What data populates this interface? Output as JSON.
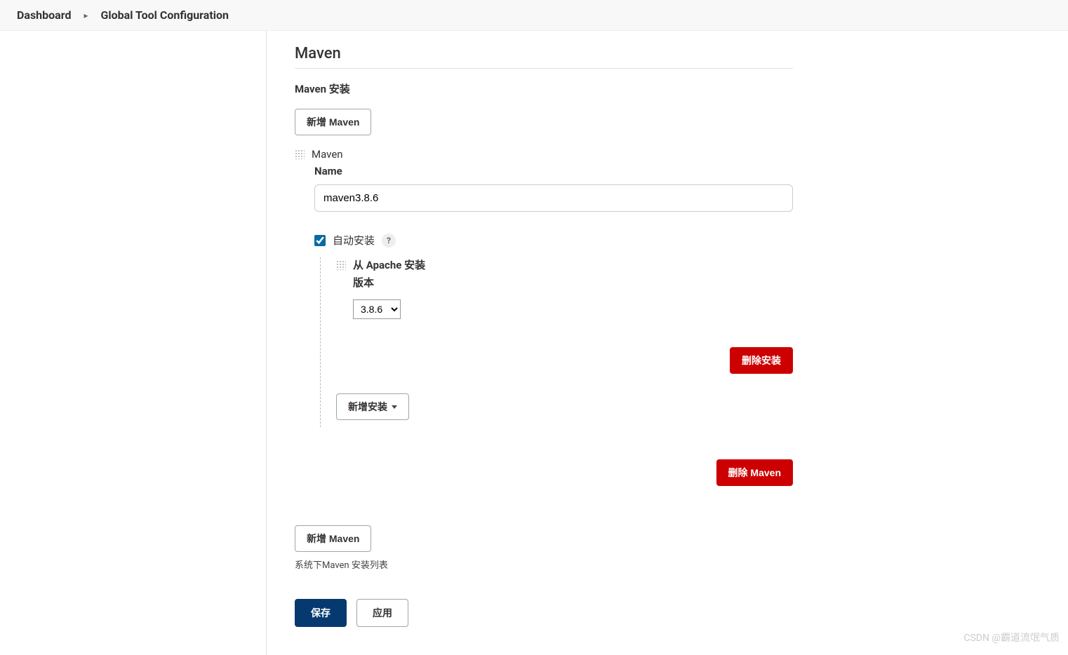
{
  "breadcrumb": {
    "items": [
      {
        "label": "Dashboard"
      },
      {
        "label": "Global Tool Configuration"
      }
    ]
  },
  "section": {
    "title": "Maven",
    "install_heading": "Maven 安装",
    "add_button_top": "新增 Maven",
    "add_button_bottom": "新增 Maven",
    "help_text": "系统下Maven 安装列表"
  },
  "tool": {
    "type_label": "Maven",
    "name_label": "Name",
    "name_value": "maven3.8.6",
    "auto_install_label": "自动安装",
    "auto_install_checked": true,
    "delete_label": "删除 Maven"
  },
  "installer": {
    "title": "从 Apache 安装",
    "version_label": "版本",
    "version_value": "3.8.6",
    "delete_label": "删除安装",
    "add_label": "新增安装"
  },
  "footer": {
    "save": "保存",
    "apply": "应用"
  },
  "watermark": "CSDN @霸道流氓气质"
}
